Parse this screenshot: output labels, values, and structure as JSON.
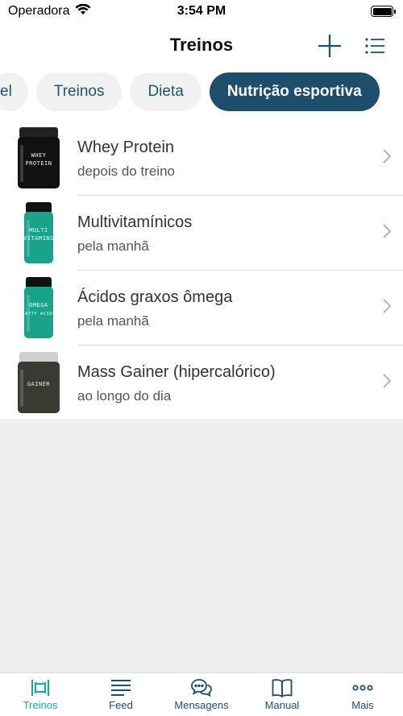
{
  "status": {
    "carrier": "Operadora",
    "time": "3:54 PM"
  },
  "header": {
    "title": "Treinos"
  },
  "tabs": [
    {
      "label": "el"
    },
    {
      "label": "Treinos"
    },
    {
      "label": "Dieta"
    },
    {
      "label": "Nutrição esportiva",
      "active": true
    }
  ],
  "items": [
    {
      "title": "Whey Protein",
      "subtitle": "depois do treino",
      "image_label": [
        "WHEY",
        "PROTEIN"
      ],
      "label_color": "#111111",
      "cap_color": "#222222",
      "text_color": "#f1f1f1"
    },
    {
      "title": "Multivitamínicos",
      "subtitle": "pela manhã",
      "image_label": [
        "MULTI",
        "VITAMINS"
      ],
      "label_color": "#17a48a",
      "cap_color": "#111111",
      "text_color": "#e8fff9"
    },
    {
      "title": "Ácidos graxos ômega",
      "subtitle": "pela manhã",
      "image_label": [
        "OMEGA",
        "FATTY ACIDS"
      ],
      "label_color": "#17a48a",
      "cap_color": "#111111",
      "text_color": "#e8fff9"
    },
    {
      "title": "Mass Gainer (hipercalórico)",
      "subtitle": "ao longo do dia",
      "image_label": [
        "GAINER"
      ],
      "label_color": "#3a3a30",
      "cap_color": "#cfcfcf",
      "text_color": "#eaeaea"
    }
  ],
  "tabbar": [
    {
      "label": "Treinos",
      "icon": "dumbbell-icon",
      "active": true
    },
    {
      "label": "Feed",
      "icon": "feed-icon"
    },
    {
      "label": "Mensagens",
      "icon": "chat-icon"
    },
    {
      "label": "Manual",
      "icon": "book-icon"
    },
    {
      "label": "Mais",
      "icon": "more-icon"
    }
  ],
  "colors": {
    "accent": "#1e4e6b",
    "active_tab": "#1aa5b5",
    "background_gray": "#efeff0"
  }
}
